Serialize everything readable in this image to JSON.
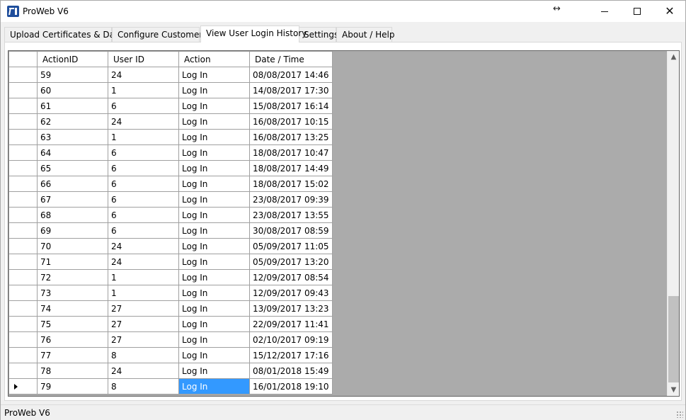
{
  "window": {
    "title": "ProWeb V6",
    "controls": {
      "minimize": "",
      "maximize": "",
      "close": "✕"
    }
  },
  "tabs": [
    {
      "label": "Upload Certificates & Data"
    },
    {
      "label": "Configure Customers"
    },
    {
      "label": "View User Login History"
    },
    {
      "label": "Settings"
    },
    {
      "label": "About / Help"
    }
  ],
  "active_tab": "View User Login History",
  "grid": {
    "columns": [
      "ActionID",
      "User ID",
      "Action",
      "Date / Time"
    ],
    "rows": [
      [
        "59",
        "24",
        "Log In",
        "08/08/2017 14:46"
      ],
      [
        "60",
        "1",
        "Log In",
        "14/08/2017 17:30"
      ],
      [
        "61",
        "6",
        "Log In",
        "15/08/2017 16:14"
      ],
      [
        "62",
        "24",
        "Log In",
        "16/08/2017 10:15"
      ],
      [
        "63",
        "1",
        "Log In",
        "16/08/2017 13:25"
      ],
      [
        "64",
        "6",
        "Log In",
        "18/08/2017 10:47"
      ],
      [
        "65",
        "6",
        "Log In",
        "18/08/2017 14:49"
      ],
      [
        "66",
        "6",
        "Log In",
        "18/08/2017 15:02"
      ],
      [
        "67",
        "6",
        "Log In",
        "23/08/2017 09:39"
      ],
      [
        "68",
        "6",
        "Log In",
        "23/08/2017 13:55"
      ],
      [
        "69",
        "6",
        "Log In",
        "30/08/2017 08:59"
      ],
      [
        "70",
        "24",
        "Log In",
        "05/09/2017 11:05"
      ],
      [
        "71",
        "24",
        "Log In",
        "05/09/2017 13:20"
      ],
      [
        "72",
        "1",
        "Log In",
        "12/09/2017 08:54"
      ],
      [
        "73",
        "1",
        "Log In",
        "12/09/2017 09:43"
      ],
      [
        "74",
        "27",
        "Log In",
        "13/09/2017 13:23"
      ],
      [
        "75",
        "27",
        "Log In",
        "22/09/2017 11:41"
      ],
      [
        "76",
        "27",
        "Log In",
        "02/10/2017 09:19"
      ],
      [
        "77",
        "8",
        "Log In",
        "15/12/2017 17:16"
      ],
      [
        "78",
        "24",
        "Log In",
        "08/01/2018 15:49"
      ],
      [
        "79",
        "8",
        "Log In",
        "16/01/2018 19:10"
      ]
    ],
    "current_row_index": 20,
    "selected_cell": {
      "row": 20,
      "column": "Action"
    },
    "selection_color": "#3399ff",
    "empty_area_color": "#ababab"
  },
  "status_bar": {
    "text": "ProWeb V6"
  }
}
